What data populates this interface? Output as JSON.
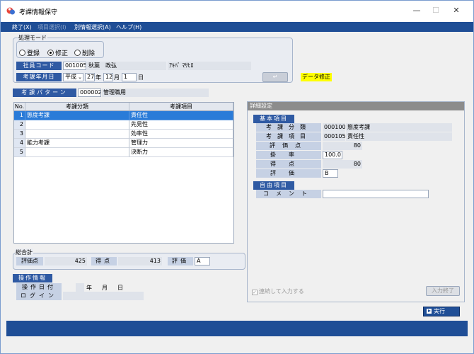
{
  "window": {
    "title": "考課情報保守",
    "minimize": "—",
    "maximize": "☐",
    "close": "✕"
  },
  "menu": [
    {
      "label": "終了(X)",
      "enabled": true
    },
    {
      "label": "項目選択(I)",
      "enabled": false
    },
    {
      "label": "別情報選択(A)",
      "enabled": true
    },
    {
      "label": "ヘルプ(H)",
      "enabled": true
    }
  ],
  "mode": {
    "legend": "処理モード",
    "options": [
      {
        "label": "登録",
        "selected": false
      },
      {
        "label": "修正",
        "selected": true
      },
      {
        "label": "削除",
        "selected": false
      }
    ]
  },
  "employee": {
    "code_label": "社員コード",
    "code": "001005",
    "name": "秋葉　政弘",
    "kana": "ｱｷﾊﾞ ﾏｻﾋﾛ"
  },
  "eval_date": {
    "label": "考課年月日",
    "era": "平成",
    "year": "27",
    "year_unit": "年",
    "month": "12",
    "month_unit": "月",
    "day": "1",
    "day_unit": "日"
  },
  "enter_button": "↵",
  "status_badge": "データ修正",
  "pattern": {
    "label": "考課パターン",
    "code": "000002",
    "name": "管理職用"
  },
  "table": {
    "headers": [
      "No.",
      "考課分類",
      "考課項目"
    ],
    "rows": [
      {
        "no": "1",
        "category": "態度考課",
        "item": "責任性",
        "selected": true
      },
      {
        "no": "2",
        "category": "",
        "item": "先見性",
        "selected": false
      },
      {
        "no": "3",
        "category": "",
        "item": "効率性",
        "selected": false
      },
      {
        "no": "4",
        "category": "能力考課",
        "item": "管理力",
        "selected": false
      },
      {
        "no": "5",
        "category": "",
        "item": "決断力",
        "selected": false
      }
    ]
  },
  "total": {
    "legend": "総合計",
    "score_label": "評価点",
    "score": "425",
    "gain_label": "得点",
    "gain": "413",
    "grade_label": "評価",
    "grade": "A"
  },
  "operation": {
    "title": "操作情報",
    "date_label": "操作日付",
    "year_unit": "年",
    "month_unit": "月",
    "day_unit": "日",
    "login_label": "ログイン",
    "login": ""
  },
  "detail": {
    "header": "詳細設定",
    "basic_title": "基本項目",
    "category_label": "考課分類",
    "category_code": "000100",
    "category_name": "態度考課",
    "item_label": "考課項目",
    "item_code": "000105",
    "item_name": "責任性",
    "points_label": "評価点",
    "points": "80",
    "rate_label": "掛率",
    "rate": "100.0",
    "gain_label": "得点",
    "gain": "80",
    "grade_label": "評価",
    "grade": "B",
    "free_title": "自由項目",
    "comment_label": "コメント",
    "comment": "",
    "continuous_label": "連続して入力する",
    "input_done": "入力終了"
  },
  "execute_button": "実行"
}
